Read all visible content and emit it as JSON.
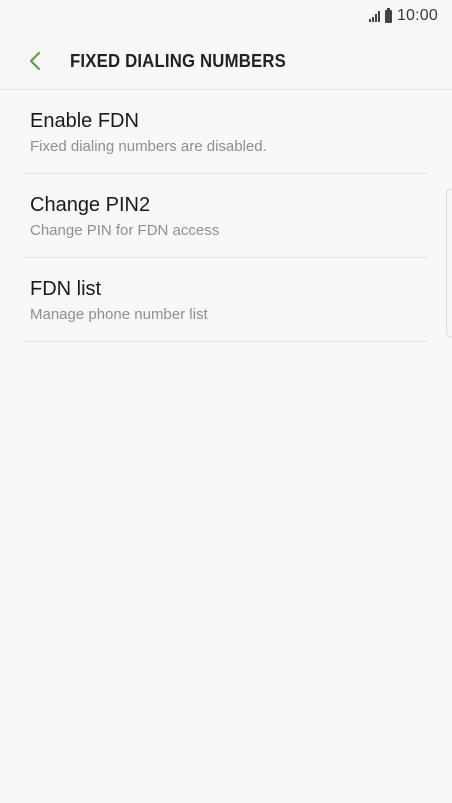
{
  "status_bar": {
    "time": "10:00",
    "icons": [
      "signal-icon",
      "battery-icon"
    ]
  },
  "header": {
    "back_icon": "chevron-left-icon",
    "title": "FIXED DIALING NUMBERS"
  },
  "settings": [
    {
      "label": "Enable FDN",
      "sub": "Fixed dialing numbers are disabled."
    },
    {
      "label": "Change PIN2",
      "sub": "Change PIN for FDN access"
    },
    {
      "label": "FDN list",
      "sub": "Manage phone number list"
    }
  ],
  "colors": {
    "accent": "#5aa146",
    "background": "#f8f8f8",
    "secondary_text": "#8f8f8f"
  }
}
